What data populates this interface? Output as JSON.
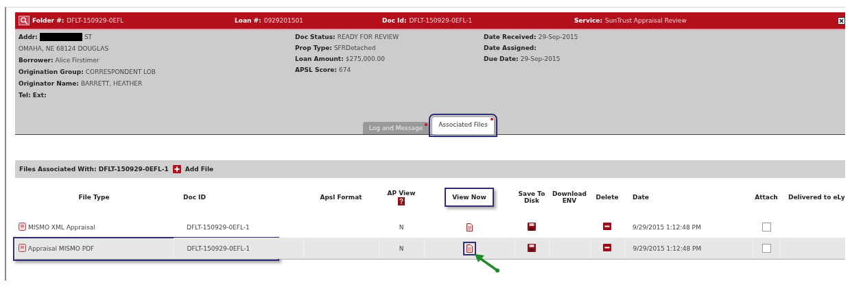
{
  "header": {
    "fields": [
      {
        "label": "Folder #:",
        "value": "DFLT-150929-0EFL"
      },
      {
        "label": "Loan #:",
        "value": "0929201501"
      },
      {
        "label": "Doc Id:",
        "value": "DFLT-150929-0EFL-1"
      },
      {
        "label": "Service:",
        "value": "SunTrust Appraisal Review"
      }
    ]
  },
  "details": {
    "columns": [
      [
        {
          "label": "Addr:",
          "value": "ST",
          "redacted": true
        },
        {
          "value": "OMAHA, NE 68124 DOUGLAS",
          "redacted": false
        },
        {
          "label": "Borrower:",
          "value": "Alice Firstimer",
          "redacted": false
        },
        {
          "label": "Origination Group:",
          "value": "CORRESPONDENT LOB",
          "redacted": false
        },
        {
          "label": "Originator Name:",
          "value": "BARRETT, HEATHER",
          "redacted": false
        },
        {
          "label": "Tel: Ext:",
          "redacted": false
        }
      ],
      [
        {
          "label": "Doc Status:",
          "value": "READY FOR REVIEW",
          "redacted": false
        },
        {
          "label": "Prop Type:",
          "value": "SFRDetached",
          "redacted": false
        },
        {
          "label": "Loan Amount:",
          "value": "$275,000.00",
          "redacted": false
        },
        {
          "label": "APSL Score:",
          "value": "674",
          "redacted": false
        }
      ],
      [
        {
          "label": "Date Received:",
          "value": "29-Sep-2015",
          "redacted": false
        },
        {
          "label": "Date Assigned:",
          "redacted": false
        },
        {
          "label": "Due Date:",
          "value": "29-Sep-2015",
          "redacted": false
        }
      ]
    ]
  },
  "tabs": [
    {
      "label": "Log and Message",
      "selected": false,
      "highlighted": false
    },
    {
      "label": "Associated Files",
      "selected": true,
      "highlighted": true
    }
  ],
  "files": {
    "title": "Files Associated With: DFLT-150929-0EFL-1",
    "add_label": "Add File",
    "columns": [
      {
        "label": "File Type",
        "kind": "file_type",
        "highlighted": false
      },
      {
        "label": "Doc ID",
        "kind": "doc_id",
        "highlighted": false
      },
      {
        "label": "Apsl Format",
        "kind": "apsl",
        "highlighted": false
      },
      {
        "label": "AP View",
        "kind": "ap_view",
        "highlighted": false
      },
      {
        "label": "View Now",
        "kind": "view",
        "highlighted": true
      },
      {
        "label": "Save To Disk",
        "kind": "save",
        "highlighted": false
      },
      {
        "label": "Download ENV",
        "kind": "download",
        "highlighted": false
      },
      {
        "label": "Delete",
        "kind": "delete",
        "highlighted": false
      },
      {
        "label": "Date",
        "kind": "date",
        "highlighted": false
      },
      {
        "label": "Attach",
        "kind": "attach",
        "highlighted": false
      },
      {
        "label": "Delivered to eLy",
        "kind": "delivered",
        "highlighted": false
      }
    ],
    "rows": [
      {
        "file_type": "MISMO XML Appraisal",
        "doc_id": "DFLT-150929-0EFL-1",
        "ap_view": "N",
        "date": "9/29/2015 1:12:48 PM",
        "checked": false,
        "shaded": false,
        "highlighted": false,
        "view_highlighted": false,
        "pointer": false
      },
      {
        "file_type": "Appraisal MISMO PDF",
        "doc_id": "DFLT-150929-0EFL-1",
        "ap_view": "N",
        "date": "9/29/2015 1:12:48 PM",
        "checked": false,
        "shaded": true,
        "highlighted": true,
        "view_highlighted": true,
        "pointer": true
      }
    ]
  }
}
